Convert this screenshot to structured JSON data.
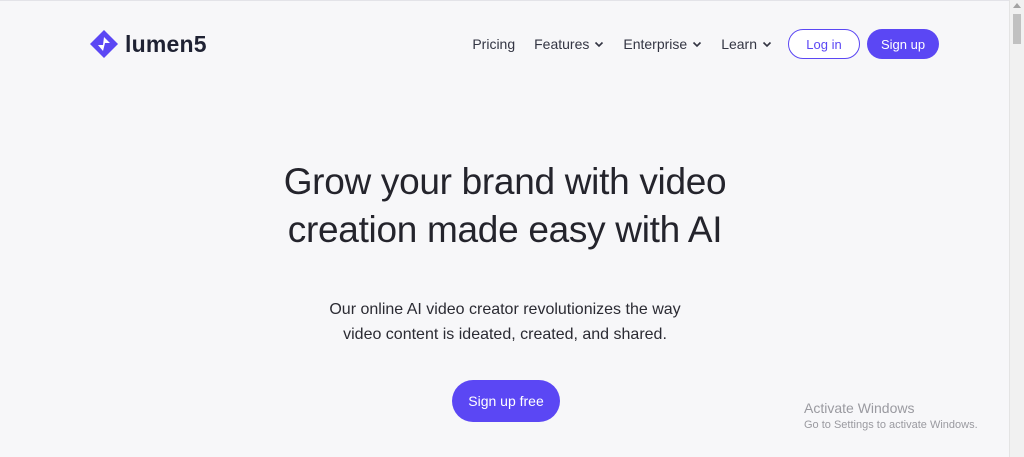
{
  "brand": {
    "name": "lumen5",
    "accent": "#5b47f4"
  },
  "nav": {
    "pricing": "Pricing",
    "features": "Features",
    "enterprise": "Enterprise",
    "learn": "Learn",
    "login": "Log in",
    "signup": "Sign up"
  },
  "hero": {
    "title_line1": "Grow your brand with video",
    "title_line2": "creation made easy with AI",
    "sub_line1": "Our online AI video creator revolutionizes the way",
    "sub_line2": "video content is ideated, created, and shared.",
    "cta": "Sign up free"
  },
  "watermark": {
    "title": "Activate Windows",
    "subtitle": "Go to Settings to activate Windows."
  },
  "icons": [
    "lumen5-logo-icon",
    "chevron-down-icon",
    "scroll-up-arrow-icon"
  ]
}
